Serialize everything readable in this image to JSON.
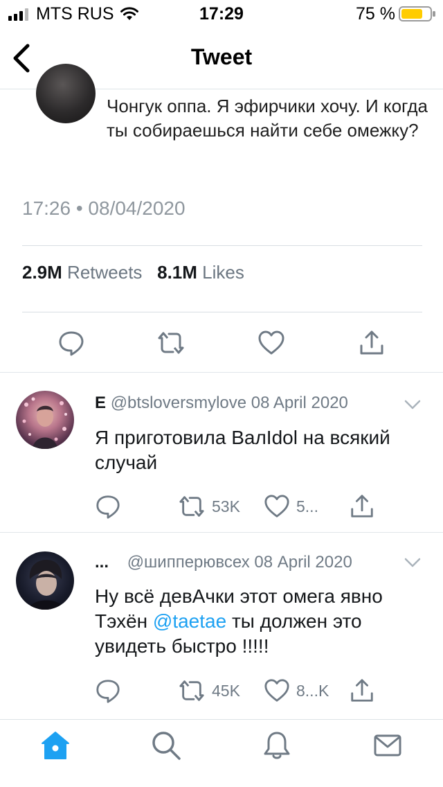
{
  "status_bar": {
    "carrier": "MTS RUS",
    "time": "17:29",
    "battery_percent": "75 %",
    "battery_level": 0.75,
    "battery_color": "#ffcc00"
  },
  "nav": {
    "title": "Tweet",
    "back_icon": "chevron-left-icon"
  },
  "tweet": {
    "text": "Чонгук оппа. Я эфирчики хочу. И когда ты собираешься найти себе омежку?",
    "timestamp": "17:26 • 08/04/2020",
    "retweets_count": "2.9M",
    "retweets_label": "Retweets",
    "likes_count": "8.1M",
    "likes_label": "Likes",
    "actions": [
      "reply-icon",
      "retweet-icon",
      "like-icon",
      "share-icon"
    ]
  },
  "replies": [
    {
      "name": "E",
      "handle": "@btsloversmylove",
      "date": "08 April 2020",
      "text": "Я приготовила ВалIdol на всякий случай",
      "retweets": "53K",
      "likes": "5..."
    },
    {
      "name": "...",
      "handle": "@шипперювсех",
      "date": "08 April 2020",
      "text_before": "Ну всё девАчки этот омега явно Тэхён ",
      "mention": "@taetae",
      "text_after": " ты должен это увидеть быстро !!!!!",
      "retweets": "45K",
      "likes": "8...K"
    }
  ],
  "tab_bar": [
    "home-icon",
    "search-icon",
    "notifications-icon",
    "messages-icon"
  ],
  "colors": {
    "accent": "#1da1f2",
    "secondary_text": "#6f7a85"
  }
}
